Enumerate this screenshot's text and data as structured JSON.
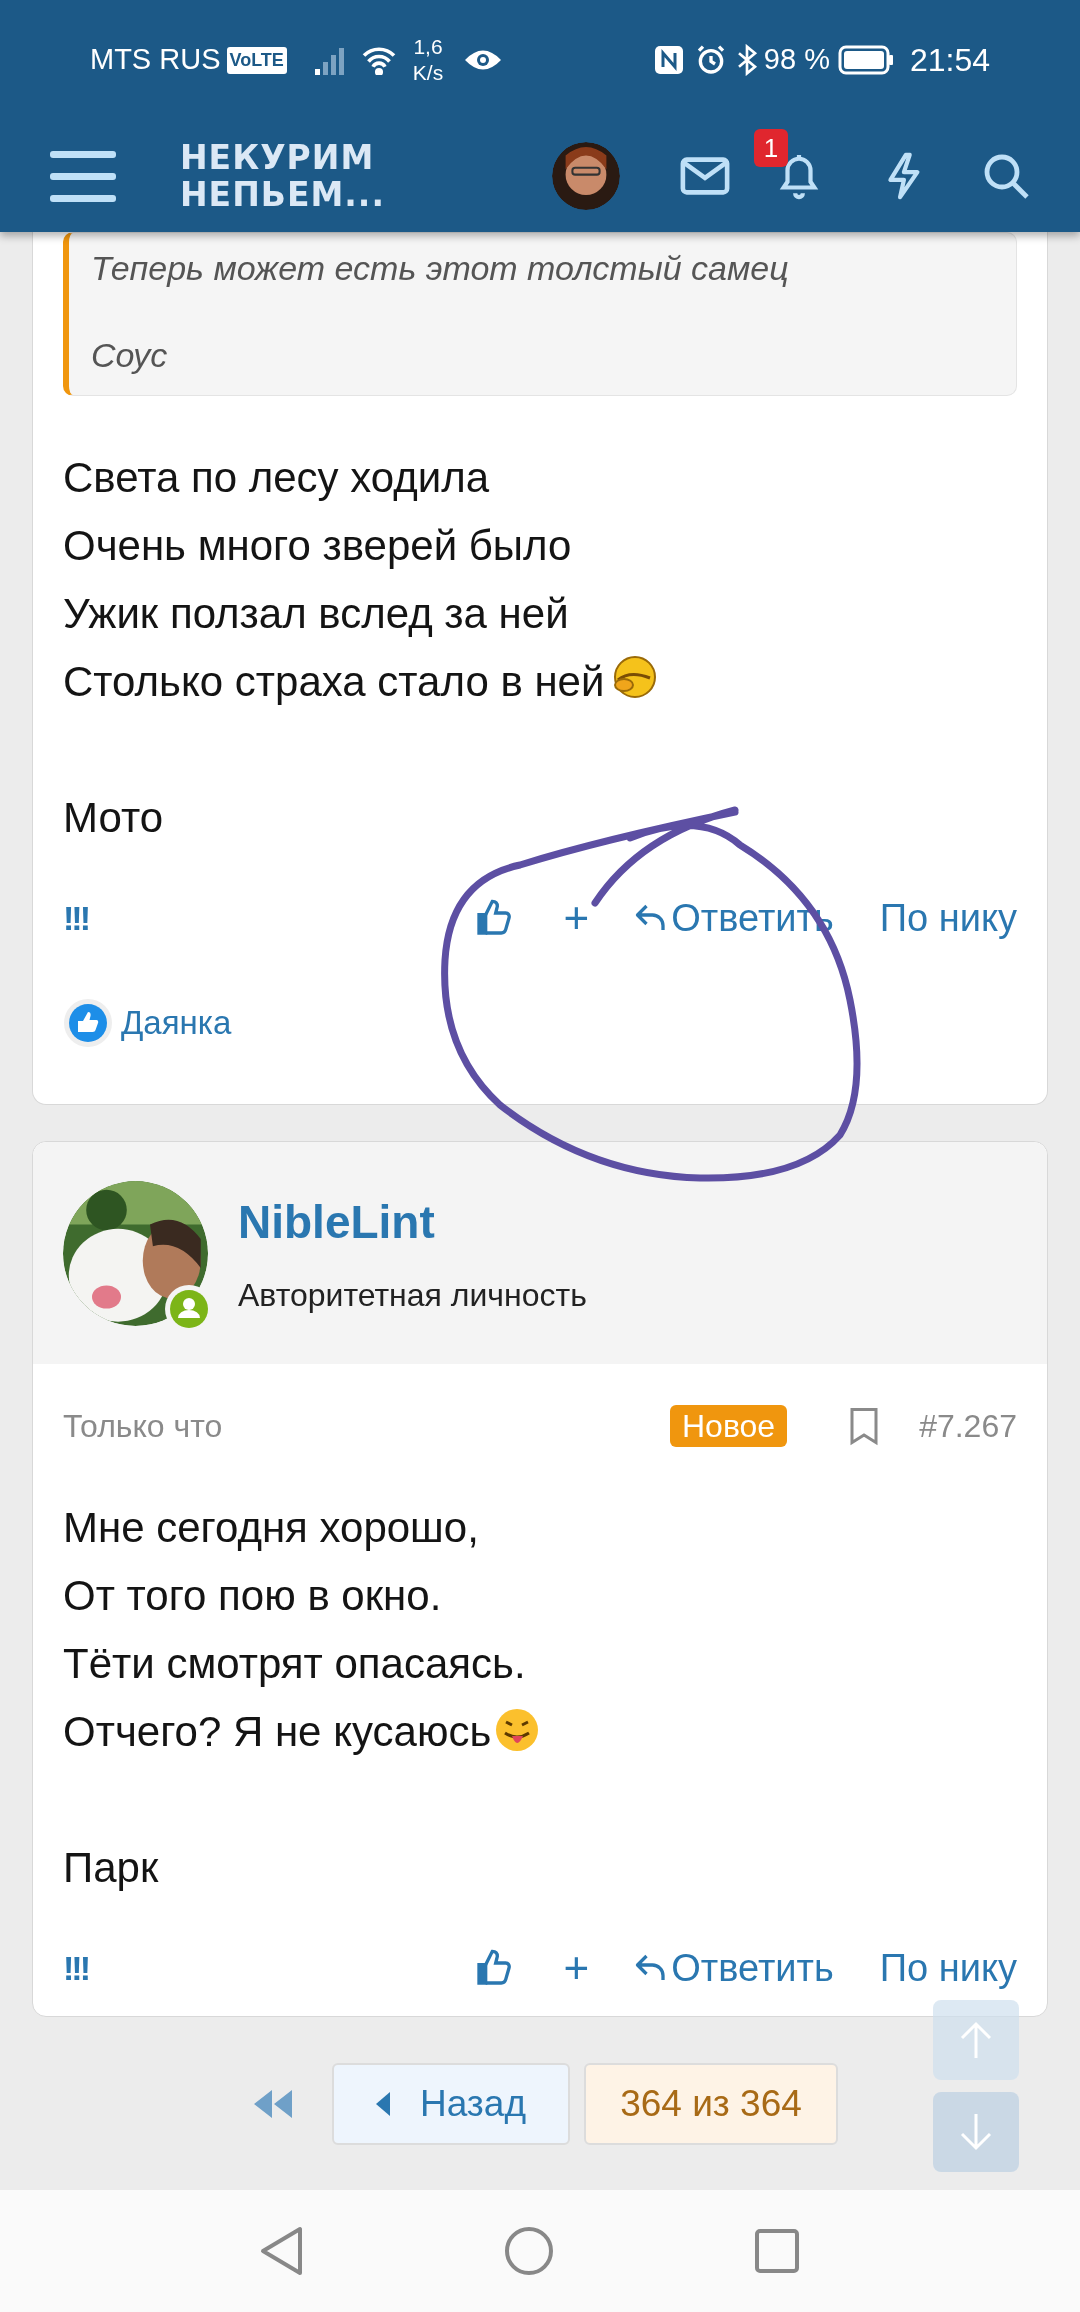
{
  "status_bar": {
    "carrier": "MTS RUS",
    "volte": "VoLTE",
    "speed": "1,6",
    "speed_unit": "K/s",
    "battery": "98 %",
    "time": "21:54"
  },
  "header": {
    "title_lines": [
      "НЕКУРИМ",
      "НЕПЬЕМ..."
    ],
    "notification_count": "1"
  },
  "posts": [
    {
      "quote": {
        "lines": [
          "Теперь может есть этот толстый самец",
          "Соус"
        ]
      },
      "paragraphs": [
        [
          {
            "kind": "plain",
            "text": "Света по лесу ходила"
          },
          {
            "kind": "plain",
            "text": "Очень много зверей было"
          },
          {
            "kind": "plain",
            "text": "Ужик ползал вслед за ней"
          },
          {
            "kind": "peek",
            "text": "Столько страха стало в ней"
          }
        ],
        [
          {
            "kind": "plain",
            "text": "Мото"
          }
        ]
      ],
      "actions": {
        "report": "!!!",
        "plus": "+",
        "reply": "Ответить",
        "quote_by_nick": "По нику"
      },
      "reactions": [
        {
          "name": "Даянка"
        }
      ]
    },
    {
      "author": {
        "name": "NibleLint",
        "title": "Авторитетная личность",
        "online": true
      },
      "time": "Только что",
      "badge": "Новое",
      "number": "#7.267",
      "paragraphs": [
        [
          {
            "kind": "plain",
            "text": "Мне сегодня хорошо,"
          },
          {
            "kind": "plain",
            "text": "От того пою в окно."
          },
          {
            "kind": "plain",
            "text": "Тёти смотрят опасаясь."
          },
          {
            "kind": "tongue",
            "text": "Отчего? Я не кусаюсь"
          }
        ],
        [
          {
            "kind": "plain",
            "text": "Парк"
          }
        ]
      ],
      "actions": {
        "report": "!!!",
        "plus": "+",
        "reply": "Ответить",
        "quote_by_nick": "По нику"
      }
    }
  ],
  "pagination": {
    "back": "Назад",
    "page": "364 из 364"
  }
}
